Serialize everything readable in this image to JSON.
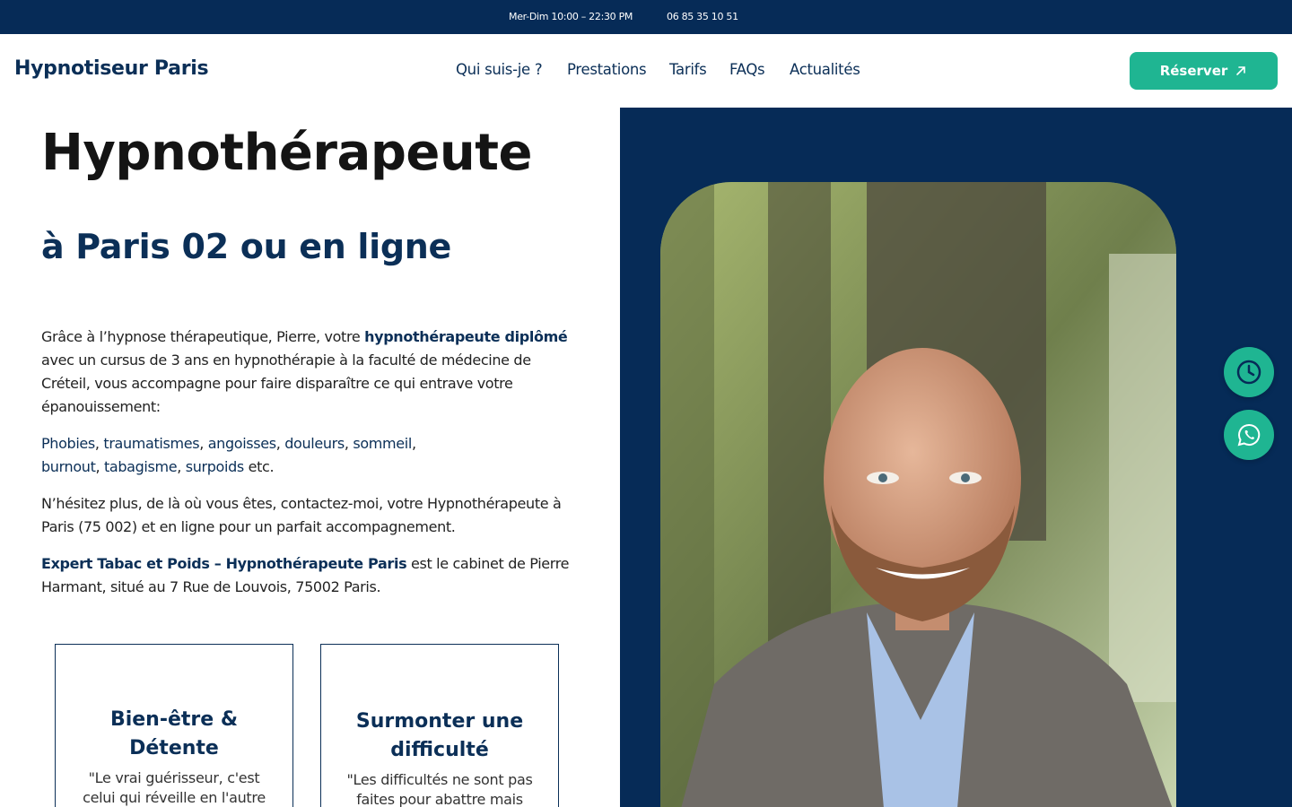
{
  "topbar": {
    "hours": "Mer-Dim 10:00 – 22:30 PM",
    "phone": "06 85 35 10 51"
  },
  "header": {
    "logo": "Hypnotiseur Paris",
    "nav": [
      "Qui suis-je ?",
      "Prestations",
      "Tarifs",
      "FAQs",
      "Actualités"
    ],
    "cta_label": "Réserver",
    "cta_icon": "arrow-up-right-icon"
  },
  "hero": {
    "title": "Hypnothérapeute",
    "subtitle": "à Paris 02 ou en ligne",
    "p1_start": "Grâce à l’hypnose thérapeutique, Pierre, votre ",
    "p1_strong": "hypnothérapeute diplômé",
    "p1_end": " avec un cursus de 3 ans en hypnothérapie à la faculté de médecine de Créteil, vous accompagne pour faire disparaître ce qui entrave votre épanouissement:",
    "issues": [
      "Phobies",
      "traumatismes",
      "angoisses",
      "douleurs",
      "sommeil",
      "burnout",
      "tabagisme",
      "surpoids"
    ],
    "issues_tail": " etc.",
    "p3": "N’hésitez plus, de là où vous êtes, contactez-moi, votre Hypnothérapeute à Paris (75 002) et en ligne pour un parfait accompagnement.",
    "p4_strong": "Expert Tabac et Poids – Hypnothérapeute Paris",
    "p4_end": " est le cabinet de Pierre Harmant, situé au 7 Rue de Louvois, 75002 Paris."
  },
  "cards": [
    {
      "title": "Bien-être & Détente",
      "quote": "\"Le vrai guérisseur, c'est celui qui réveille en l'autre"
    },
    {
      "title": "Surmonter une difficulté",
      "quote": "\"Les difficultés ne sont pas faites pour abattre mais"
    }
  ],
  "floating": {
    "clock_icon": "clock-icon",
    "whatsapp_icon": "whatsapp-icon"
  },
  "colors": {
    "navy": "#062b57",
    "accent": "#1fb592"
  }
}
